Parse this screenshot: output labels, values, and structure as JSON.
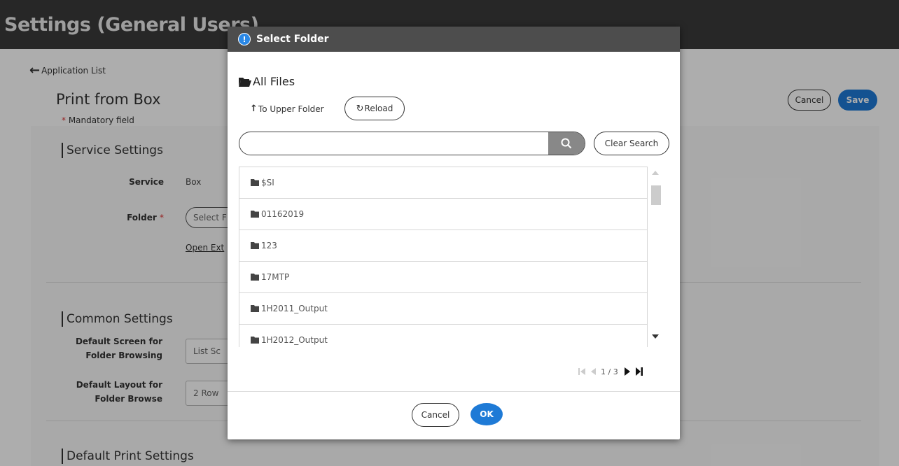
{
  "header": {
    "title": "Settings (General Users)"
  },
  "nav": {
    "back_label": "Application List"
  },
  "page": {
    "title": "Print from Box",
    "mandatory_note": "Mandatory field",
    "cancel_label": "Cancel",
    "save_label": "Save"
  },
  "service_settings": {
    "heading": "Service Settings",
    "service_label": "Service",
    "service_value": "Box",
    "folder_label": "Folder",
    "folder_button": "Select F",
    "open_link": "Open Ext"
  },
  "common_settings": {
    "heading": "Common Settings",
    "screen_label_1": "Default Screen for",
    "screen_label_2": "Folder Browsing",
    "screen_value": "List Sc",
    "layout_label_1": "Default Layout for",
    "layout_label_2": "Folder Browse",
    "layout_value": "2 Row"
  },
  "print_settings": {
    "heading": "Default Print Settings"
  },
  "dialog": {
    "title": "Select Folder",
    "current_folder": "All Files",
    "upper_folder": "To Upper Folder",
    "reload": "Reload",
    "search": {
      "value": "",
      "placeholder": ""
    },
    "clear_search": "Clear Search",
    "folders": [
      "$SI",
      "01162019",
      "123",
      "17MTP",
      "1H2011_Output",
      "1H2012_Output"
    ],
    "pagination": {
      "current": "1",
      "total": "3",
      "separator": " / "
    },
    "cancel_label": "Cancel",
    "ok_label": "OK"
  },
  "colors": {
    "accent": "#1e7ad6",
    "header_bg": "#3a3a3a",
    "dialog_header": "#4d4d4d"
  }
}
